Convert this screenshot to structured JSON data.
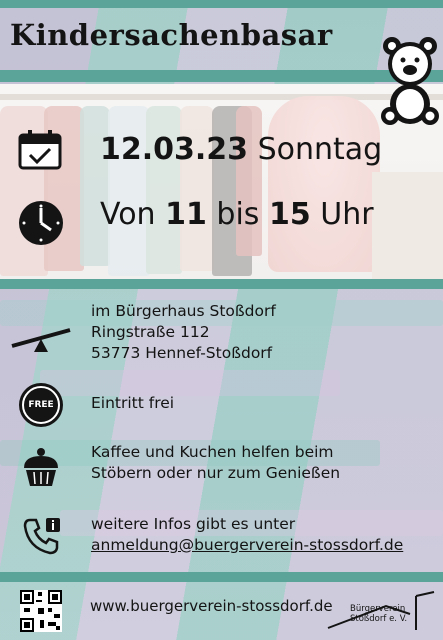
{
  "header": {
    "title": "Kindersachenbasar"
  },
  "event": {
    "date": "12.03.23",
    "weekday": "Sonntag",
    "time_prefix": "Von",
    "time_start": "11",
    "time_mid": "bis",
    "time_end": "15",
    "time_suffix": "Uhr"
  },
  "location": {
    "venue": "im Bürgerhaus Stoßdorf",
    "street": "Ringstraße 112",
    "city": "53773 Hennef-Stoßdorf"
  },
  "admission": {
    "badge": "FREE",
    "text": "Eintritt frei"
  },
  "cafe": {
    "line1": "Kaffee und Kuchen helfen beim",
    "line2": "Stöbern oder nur zum Genießen"
  },
  "contact": {
    "line1": "weitere Infos gibt es unter",
    "email": "anmeldung@buergerverein-stossdorf.de"
  },
  "footer": {
    "website": "www.buergerverein-stossdorf.de",
    "logo_line1": "Bürgerverein",
    "logo_line2": "Stoßdorf e. V."
  },
  "colors": {
    "band": "#5aa49a",
    "text": "#141414"
  }
}
